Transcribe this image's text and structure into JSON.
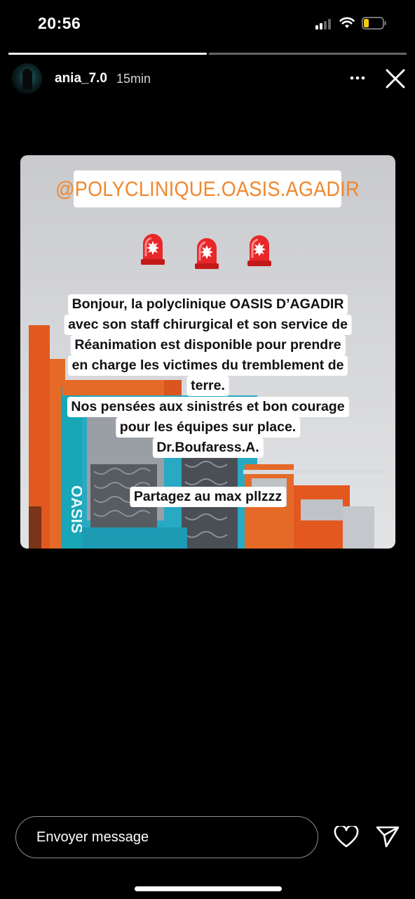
{
  "status_bar": {
    "time": "20:56",
    "battery_color": "#f7c90a",
    "icons": [
      "signal-icon",
      "wifi-icon",
      "battery-icon"
    ]
  },
  "story": {
    "username": "ania_7.0",
    "time_ago": "15min",
    "segments_total": 2,
    "segments_seen": 1,
    "more_icon": "more-dots-icon",
    "close_icon": "close-icon"
  },
  "card": {
    "tag": "@POLYCLINIQUE.OASIS.AGADIR",
    "tag_color": "#f0872d",
    "lines": [
      "Bonjour, la polyclinique OASIS D’AGADIR",
      "avec son staff chirurgical et son service de",
      "Réanimation est disponible pour prendre",
      "en charge les victimes du tremblement de",
      "terre.",
      "Nos pensées aux sinistrés et bon courage",
      "pour les équipes sur place.",
      "Dr.Boufaress.A."
    ],
    "share_text": "Partagez au max pllzzz",
    "siren_icon": "siren-icon"
  },
  "message_bar": {
    "placeholder": "Envoyer message",
    "like_icon": "heart-icon",
    "send_icon": "send-icon"
  }
}
